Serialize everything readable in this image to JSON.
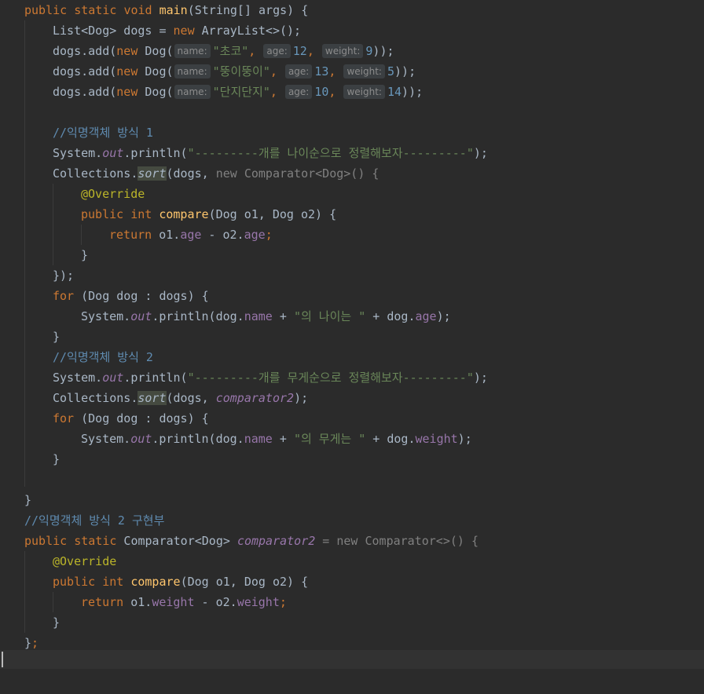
{
  "editor": {
    "language": "Java",
    "theme": {
      "background": "#2b2b2b",
      "keyword": "#cc7832",
      "string": "#6a8759",
      "number": "#6897bb",
      "method_decl": "#ffc66d",
      "field": "#9876aa",
      "comment": "#5f8bb0",
      "annotation": "#bbb529"
    },
    "lines": [
      "public static void main(String[] args) {",
      "List<Dog> dogs = new ArrayList<>();",
      "dogs.add(new Dog(name: \"초코\", age: 12, weight: 9));",
      "dogs.add(new Dog(name: \"뚱이뚱이\", age: 13, weight: 5));",
      "dogs.add(new Dog(name: \"단지단지\", age: 10, weight: 14));",
      "",
      "//익명객체 방식 1",
      "System.out.println(\"---------개를 나이순으로 정렬해보자---------\");",
      "Collections.sort(dogs, new Comparator<Dog>() {",
      "@Override",
      "public int compare(Dog o1, Dog o2) {",
      "return o1.age - o2.age;",
      "}",
      "});",
      "for (Dog dog : dogs) {",
      "System.out.println(dog.name + \"의 나이는 \" + dog.age);",
      "}",
      "//익명객체 방식 2",
      "System.out.println(\"---------개를 무게순으로 정렬해보자---------\");",
      "Collections.sort(dogs, comparator2);",
      "for (Dog dog : dogs) {",
      "System.out.println(dog.name + \"의 무게는 \" + dog.weight);",
      "}",
      "",
      "}",
      "//익명객체 방식 2 구현부",
      "public static Comparator<Dog> comparator2 = new Comparator<>() {",
      "@Override",
      "public int compare(Dog o1, Dog o2) {",
      "return o1.weight - o2.weight;",
      "}",
      "};"
    ],
    "tokens": {
      "public": "public",
      "static": "static",
      "void": "void",
      "main": "main",
      "main_sig": "(String[] args) {",
      "list_decl": "List<Dog> dogs = ",
      "new": "new",
      "arraylist": " ArrayList<>();",
      "dogs_add": "dogs.add(",
      "dog_ctor": " Dog(",
      "hint_name": "name:",
      "hint_age": "age:",
      "hint_weight": "weight:",
      "dog1_name": "\"초코\"",
      "dog1_age": "12",
      "dog1_weight": "9",
      "dog2_name": "\"뚱이뚱이\"",
      "dog2_age": "13",
      "dog2_weight": "5",
      "dog3_name": "\"단지단지\"",
      "dog3_age": "10",
      "dog3_weight": "14",
      "comma": ", ",
      "close_add": "));",
      "comment1": "//익명객체 방식 1",
      "system": "System.",
      "out": "out",
      "println_open": ".println(",
      "str_age": "\"---------개를 나이순으로 정렬해보자---------\"",
      "close_paren_semi": ");",
      "collections": "Collections.",
      "sort": "sort",
      "sort_args1": "(dogs, ",
      "new_comparator_dog": "new Comparator<Dog>() {",
      "override": "@Override",
      "int": "int",
      "compare": "compare",
      "compare_sig": "(Dog o1, Dog o2) {",
      "return": "return",
      "o1": " o1.",
      "o2": " - o2.",
      "age": "age",
      "weight": "weight",
      "semi": ";",
      "brace_close": "}",
      "close_anon": "});",
      "for": "for",
      "for_sig": " (Dog dog : dogs) {",
      "dog_dot": "dog.",
      "name": "name",
      "plus": " + ",
      "str_age_is": "\"의 나이는 \"",
      "str_weight_is": "\"의 무게는 \"",
      "comment2": "//익명객체 방식 2",
      "str_weight": "\"---------개를 무게순으로 정렬해보자---------\"",
      "sort_args2": "(dogs, ",
      "comparator2": "comparator2",
      "comment3": "//익명객체 방식 2 구현부",
      "comparator_type": " Comparator<Dog> ",
      "eq_new_comparator": " = new Comparator<>() {",
      "end_semi": "};"
    }
  }
}
